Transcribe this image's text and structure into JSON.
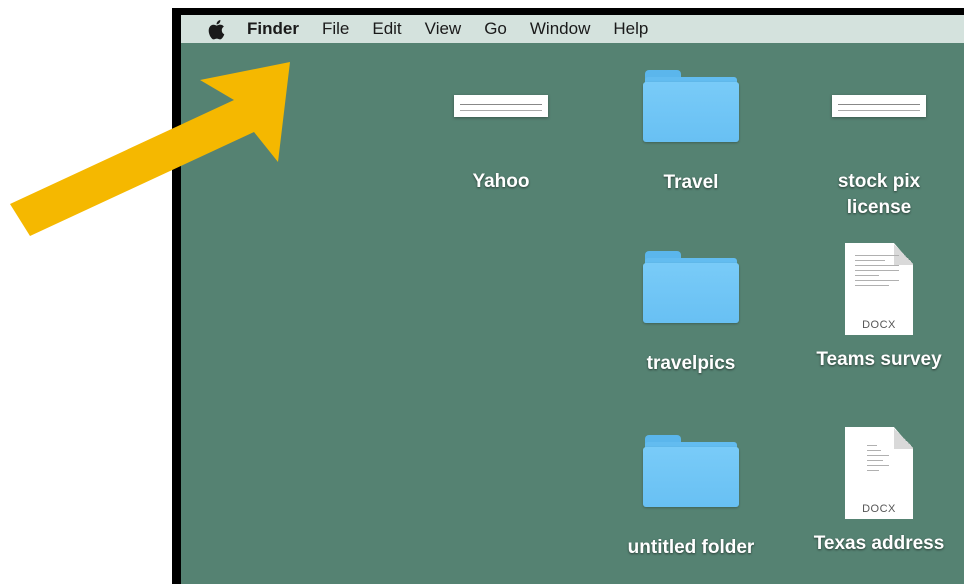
{
  "menubar": {
    "apple_icon": "apple-logo-icon",
    "items": [
      {
        "label": "Finder",
        "bold": true
      },
      {
        "label": "File"
      },
      {
        "label": "Edit"
      },
      {
        "label": "View"
      },
      {
        "label": "Go"
      },
      {
        "label": "Window"
      },
      {
        "label": "Help"
      }
    ]
  },
  "desktop": {
    "background_color": "#558272",
    "icons": [
      {
        "label": "Yahoo",
        "kind": "screenshot-thumbnail"
      },
      {
        "label": "Travel",
        "kind": "folder"
      },
      {
        "label_line1": "stock pix",
        "label_line2": "license",
        "kind": "screenshot-thumbnail"
      },
      {
        "label": "travelpics",
        "kind": "folder"
      },
      {
        "label": "Teams survey",
        "kind": "docx",
        "badge": "DOCX"
      },
      {
        "label": "untitled folder",
        "kind": "folder"
      },
      {
        "label": "Texas address",
        "kind": "docx",
        "badge": "DOCX"
      }
    ]
  },
  "annotation": {
    "arrow_color": "#f5b800",
    "points_to": "Finder menu"
  }
}
